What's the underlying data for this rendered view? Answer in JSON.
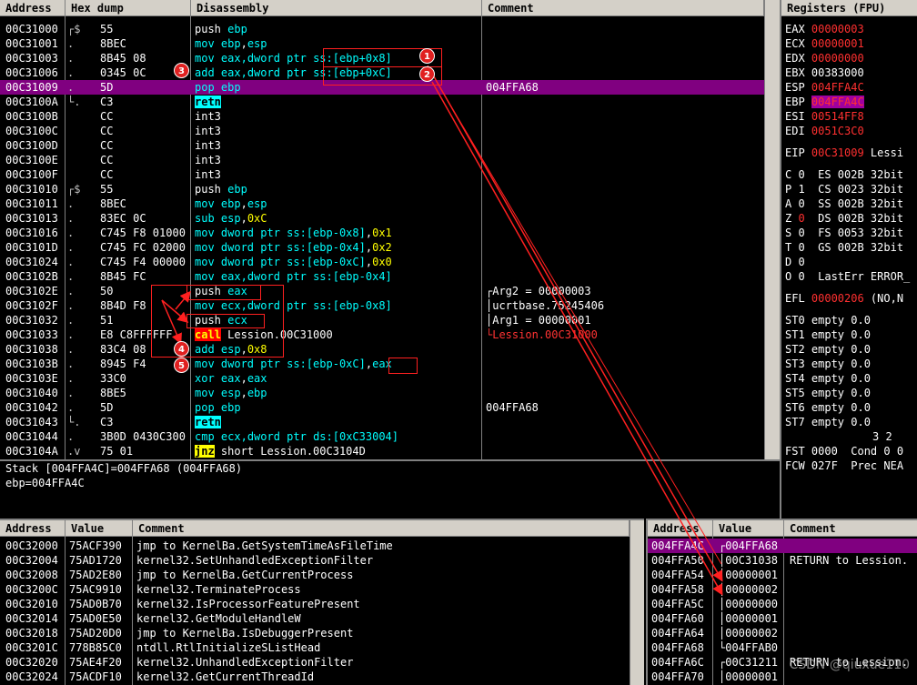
{
  "disasm": {
    "headers": {
      "address": "Address",
      "hex": "Hex dump",
      "disasm": "Disassembly",
      "comment": "Comment"
    },
    "rows": [
      {
        "addr": "00C31000",
        "mark": "┌$",
        "hex": "55",
        "ins": [
          [
            "push ",
            "w"
          ],
          [
            "ebp",
            "k"
          ]
        ],
        "cmt": ""
      },
      {
        "addr": "00C31001",
        "mark": ".",
        "hex": "8BEC",
        "ins": [
          [
            "mov ",
            "k"
          ],
          [
            "ebp",
            "k"
          ],
          [
            ",",
            "w"
          ],
          [
            "esp",
            "k"
          ]
        ],
        "cmt": ""
      },
      {
        "addr": "00C31003",
        "mark": ".",
        "hex": "8B45 08",
        "ins": [
          [
            "mov ",
            "k"
          ],
          [
            "eax",
            "k"
          ],
          [
            ",dword ptr ",
            "k"
          ],
          [
            "ss:[ebp+0x8]",
            "k"
          ]
        ],
        "cmt": ""
      },
      {
        "addr": "00C31006",
        "mark": ".",
        "hex": "0345 0C",
        "ins": [
          [
            "add ",
            "k"
          ],
          [
            "eax",
            "k"
          ],
          [
            ",dword ptr ",
            "k"
          ],
          [
            "ss:[ebp+0xC]",
            "k"
          ]
        ],
        "cmt": ""
      },
      {
        "addr": "00C31009",
        "mark": ".",
        "hex": "5D",
        "ins": [
          [
            "pop ebp",
            "k"
          ]
        ],
        "cmt": "004FFA68",
        "sel": true
      },
      {
        "addr": "00C3100A",
        "mark": "└.",
        "hex": "C3",
        "ins": [
          [
            "retn",
            "ret"
          ]
        ],
        "cmt": ""
      },
      {
        "addr": "00C3100B",
        "mark": "",
        "hex": "CC",
        "ins": [
          [
            "int3",
            "g"
          ]
        ],
        "cmt": ""
      },
      {
        "addr": "00C3100C",
        "mark": "",
        "hex": "CC",
        "ins": [
          [
            "int3",
            "g"
          ]
        ],
        "cmt": ""
      },
      {
        "addr": "00C3100D",
        "mark": "",
        "hex": "CC",
        "ins": [
          [
            "int3",
            "g"
          ]
        ],
        "cmt": ""
      },
      {
        "addr": "00C3100E",
        "mark": "",
        "hex": "CC",
        "ins": [
          [
            "int3",
            "g"
          ]
        ],
        "cmt": ""
      },
      {
        "addr": "00C3100F",
        "mark": "",
        "hex": "CC",
        "ins": [
          [
            "int3",
            "g"
          ]
        ],
        "cmt": ""
      },
      {
        "addr": "00C31010",
        "mark": "┌$",
        "hex": "55",
        "ins": [
          [
            "push ",
            "w"
          ],
          [
            "ebp",
            "k"
          ]
        ],
        "cmt": ""
      },
      {
        "addr": "00C31011",
        "mark": ".",
        "hex": "8BEC",
        "ins": [
          [
            "mov ",
            "k"
          ],
          [
            "ebp",
            "k"
          ],
          [
            ",",
            "w"
          ],
          [
            "esp",
            "k"
          ]
        ],
        "cmt": ""
      },
      {
        "addr": "00C31013",
        "mark": ".",
        "hex": "83EC 0C",
        "ins": [
          [
            "sub ",
            "k"
          ],
          [
            "esp",
            "k"
          ],
          [
            ",",
            "w"
          ],
          [
            "0xC",
            "y"
          ]
        ],
        "cmt": ""
      },
      {
        "addr": "00C31016",
        "mark": ".",
        "hex": "C745 F8 01000",
        "ins": [
          [
            "mov dword ptr ",
            "k"
          ],
          [
            "ss:[ebp-0x8]",
            "k"
          ],
          [
            ",",
            "w"
          ],
          [
            "0x1",
            "y"
          ]
        ],
        "cmt": ""
      },
      {
        "addr": "00C3101D",
        "mark": ".",
        "hex": "C745 FC 02000",
        "ins": [
          [
            "mov dword ptr ",
            "k"
          ],
          [
            "ss:[ebp-0x4]",
            "k"
          ],
          [
            ",",
            "w"
          ],
          [
            "0x2",
            "y"
          ]
        ],
        "cmt": ""
      },
      {
        "addr": "00C31024",
        "mark": ".",
        "hex": "C745 F4 00000",
        "ins": [
          [
            "mov dword ptr ",
            "k"
          ],
          [
            "ss:[ebp-0xC]",
            "k"
          ],
          [
            ",",
            "w"
          ],
          [
            "0x0",
            "y"
          ]
        ],
        "cmt": ""
      },
      {
        "addr": "00C3102B",
        "mark": ".",
        "hex": "8B45 FC",
        "ins": [
          [
            "mov ",
            "k"
          ],
          [
            "eax",
            "k"
          ],
          [
            ",dword ptr ",
            "k"
          ],
          [
            "ss:[ebp-0x4]",
            "k"
          ]
        ],
        "cmt": ""
      },
      {
        "addr": "00C3102E",
        "mark": ".",
        "hex": "50",
        "ins": [
          [
            "push ",
            "w"
          ],
          [
            "eax",
            "k"
          ]
        ],
        "cmt": "┌Arg2 = 00000003"
      },
      {
        "addr": "00C3102F",
        "mark": ".",
        "hex": "8B4D F8",
        "ins": [
          [
            "mov ",
            "k"
          ],
          [
            "ecx",
            "k"
          ],
          [
            ",dword ptr ",
            "k"
          ],
          [
            "ss:[ebp-0x8]",
            "k"
          ]
        ],
        "cmt": "│ucrtbase.75245406"
      },
      {
        "addr": "00C31032",
        "mark": ".",
        "hex": "51",
        "ins": [
          [
            "push ",
            "w"
          ],
          [
            "ecx",
            "k"
          ]
        ],
        "cmt": "│Arg1 = 00000001"
      },
      {
        "addr": "00C31033",
        "mark": ".",
        "hex": "E8 C8FFFFFF",
        "ins": [
          [
            "call",
            "call"
          ],
          [
            " Lession.00C31000",
            "w"
          ]
        ],
        "cmt": "└Lession.00C31000",
        "cmtred": true
      },
      {
        "addr": "00C31038",
        "mark": ".",
        "hex": "83C4 08",
        "ins": [
          [
            "add ",
            "k"
          ],
          [
            "esp",
            "k"
          ],
          [
            ",",
            "w"
          ],
          [
            "0x8",
            "y"
          ]
        ],
        "cmt": ""
      },
      {
        "addr": "00C3103B",
        "mark": ".",
        "hex": "8945 F4",
        "ins": [
          [
            "mov dword ptr ",
            "k"
          ],
          [
            "ss:[ebp-0xC]",
            "k"
          ],
          [
            ",",
            "w"
          ],
          [
            "eax",
            "k"
          ]
        ],
        "cmt": ""
      },
      {
        "addr": "00C3103E",
        "mark": ".",
        "hex": "33C0",
        "ins": [
          [
            "xor ",
            "k"
          ],
          [
            "eax",
            "k"
          ],
          [
            ",",
            "w"
          ],
          [
            "eax",
            "k"
          ]
        ],
        "cmt": ""
      },
      {
        "addr": "00C31040",
        "mark": ".",
        "hex": "8BE5",
        "ins": [
          [
            "mov ",
            "k"
          ],
          [
            "esp",
            "k"
          ],
          [
            ",",
            "w"
          ],
          [
            "ebp",
            "k"
          ]
        ],
        "cmt": ""
      },
      {
        "addr": "00C31042",
        "mark": ".",
        "hex": "5D",
        "ins": [
          [
            "pop ",
            "k"
          ],
          [
            "ebp",
            "k"
          ]
        ],
        "cmt": "004FFA68"
      },
      {
        "addr": "00C31043",
        "mark": "└.",
        "hex": "C3",
        "ins": [
          [
            "retn",
            "ret"
          ]
        ],
        "cmt": ""
      },
      {
        "addr": "00C31044",
        "mark": ".",
        "hex": "3B0D 0430C300",
        "ins": [
          [
            "cmp ",
            "k"
          ],
          [
            "ecx",
            "k"
          ],
          [
            ",dword ptr ",
            "k"
          ],
          [
            "ds:[0xC33004]",
            "k"
          ]
        ],
        "cmt": ""
      },
      {
        "addr": "00C3104A",
        "mark": ".v",
        "hex": "75 01",
        "ins": [
          [
            "jnz",
            "jmp"
          ],
          [
            " short Lession.00C3104D",
            "w"
          ]
        ],
        "cmt": ""
      }
    ]
  },
  "info": {
    "line1": "Stack [004FFA4C]=004FFA68 (004FFA68)",
    "line2": "ebp=004FFA4C"
  },
  "registers": {
    "header": "Registers (FPU)",
    "gp": [
      {
        "name": "EAX",
        "val": "00000003",
        "style": "red",
        "extra": ""
      },
      {
        "name": "ECX",
        "val": "00000001",
        "style": "red",
        "extra": ""
      },
      {
        "name": "EDX",
        "val": "00000000",
        "style": "red",
        "extra": ""
      },
      {
        "name": "EBX",
        "val": "00383000",
        "style": "white",
        "extra": ""
      },
      {
        "name": "ESP",
        "val": "004FFA4C",
        "style": "red",
        "extra": ""
      },
      {
        "name": "EBP",
        "val": "004FFA4C",
        "style": "hi",
        "extra": ""
      },
      {
        "name": "ESI",
        "val": "00514FF8",
        "style": "red",
        "extra": ""
      },
      {
        "name": "EDI",
        "val": "0051C3C0",
        "style": "red",
        "extra": ""
      }
    ],
    "eip": {
      "name": "EIP",
      "val": "00C31009",
      "extra": " Lessi"
    },
    "flags": [
      {
        "f": "C",
        "v": "0",
        "vred": false,
        "seg": "ES",
        "sv": "002B",
        "bits": "32bit"
      },
      {
        "f": "P",
        "v": "1",
        "vred": false,
        "seg": "CS",
        "sv": "0023",
        "bits": "32bit"
      },
      {
        "f": "A",
        "v": "0",
        "vred": false,
        "seg": "SS",
        "sv": "002B",
        "bits": "32bit"
      },
      {
        "f": "Z",
        "v": "0",
        "vred": true,
        "seg": "DS",
        "sv": "002B",
        "bits": "32bit"
      },
      {
        "f": "S",
        "v": "0",
        "vred": false,
        "seg": "FS",
        "sv": "0053",
        "bits": "32bit"
      },
      {
        "f": "T",
        "v": "0",
        "vred": false,
        "seg": "GS",
        "sv": "002B",
        "bits": "32bit"
      },
      {
        "f": "D",
        "v": "0",
        "vred": false,
        "seg": "",
        "sv": "",
        "bits": ""
      },
      {
        "f": "O",
        "v": "0",
        "vred": false,
        "seg": "LastErr",
        "sv": "ERROR_",
        "bits": ""
      }
    ],
    "efl": {
      "name": "EFL",
      "val": "00000206",
      "extra": " (NO,N"
    },
    "fpu": [
      "ST0 empty 0.0",
      "ST1 empty 0.0",
      "ST2 empty 0.0",
      "ST3 empty 0.0",
      "ST4 empty 0.0",
      "ST5 empty 0.0",
      "ST6 empty 0.0",
      "ST7 empty 0.0"
    ],
    "fpu_tail": "3 2",
    "fst": "FST 0000  Cond 0 0",
    "fcw": "FCW 027F  Prec NEA"
  },
  "dump": {
    "headers": {
      "address": "Address",
      "value": "Value",
      "comment": "Comment"
    },
    "rows": [
      {
        "a": "00C32000",
        "v": "75ACF390",
        "c": "jmp to KernelBa.GetSystemTimeAsFileTime"
      },
      {
        "a": "00C32004",
        "v": "75AD1720",
        "c": "kernel32.SetUnhandledExceptionFilter"
      },
      {
        "a": "00C32008",
        "v": "75AD2E80",
        "c": "jmp to KernelBa.GetCurrentProcess"
      },
      {
        "a": "00C3200C",
        "v": "75AC9910",
        "c": "kernel32.TerminateProcess"
      },
      {
        "a": "00C32010",
        "v": "75AD0B70",
        "c": "kernel32.IsProcessorFeaturePresent"
      },
      {
        "a": "00C32014",
        "v": "75AD0E50",
        "c": "kernel32.GetModuleHandleW"
      },
      {
        "a": "00C32018",
        "v": "75AD20D0",
        "c": "jmp to KernelBa.IsDebuggerPresent"
      },
      {
        "a": "00C3201C",
        "v": "778B85C0",
        "c": "ntdll.RtlInitializeSListHead"
      },
      {
        "a": "00C32020",
        "v": "75AE4F20",
        "c": "kernel32.UnhandledExceptionFilter"
      },
      {
        "a": "00C32024",
        "v": "75ACDF10",
        "c": "kernel32.GetCurrentThreadId"
      }
    ]
  },
  "stack": {
    "headers": {
      "address": "Address",
      "value": "Value",
      "comment": "Comment"
    },
    "rows": [
      {
        "a": "004FFA4C",
        "v": "┌004FFA68",
        "c": "",
        "sel": true
      },
      {
        "a": "004FFA50",
        "v": "│00C31038",
        "c": "RETURN to Lession."
      },
      {
        "a": "004FFA54",
        "v": "│00000001",
        "c": ""
      },
      {
        "a": "004FFA58",
        "v": "│00000002",
        "c": ""
      },
      {
        "a": "004FFA5C",
        "v": "│00000000",
        "c": ""
      },
      {
        "a": "004FFA60",
        "v": "│00000001",
        "c": ""
      },
      {
        "a": "004FFA64",
        "v": "│00000002",
        "c": ""
      },
      {
        "a": "004FFA68",
        "v": "└004FFAB0",
        "c": ""
      },
      {
        "a": "004FFA6C",
        "v": "┌00C31211",
        "c": "RETURN to Lession."
      },
      {
        "a": "004FFA70",
        "v": "│00000001",
        "c": ""
      }
    ]
  },
  "annotations": [
    "1",
    "2",
    "3",
    "4",
    "5"
  ],
  "watermark": "CSDN @qiuxue110"
}
